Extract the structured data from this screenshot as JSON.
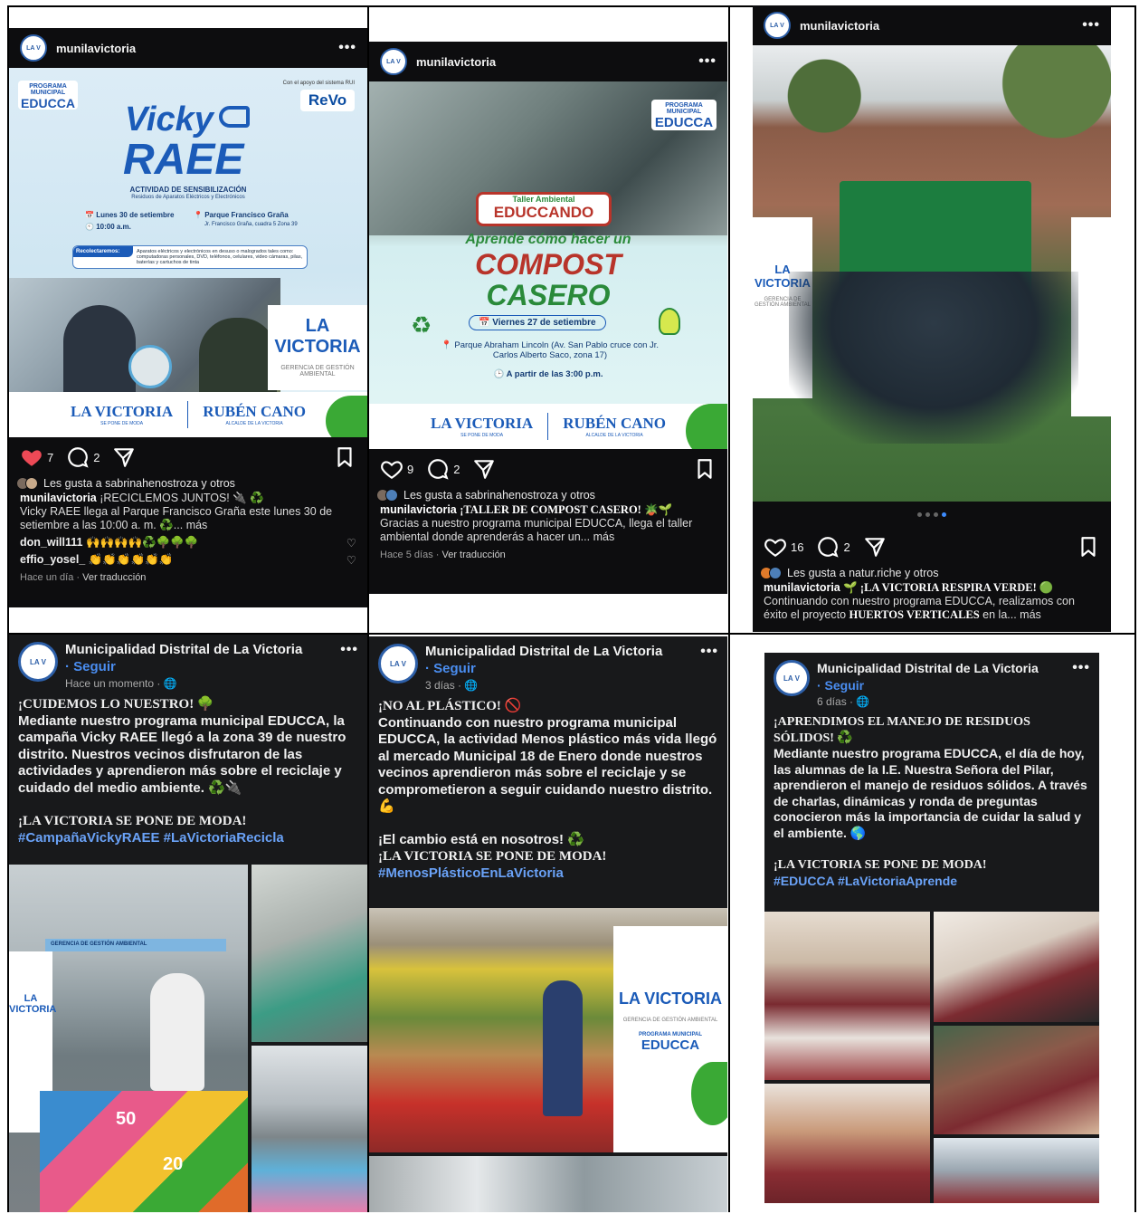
{
  "ig_posts": [
    {
      "username": "munilavictoria",
      "menu": "•••",
      "likes_count": "7",
      "comments_count": "2",
      "liked_by": "Les gusta a sabrinahenostroza y otros",
      "caption_user": "munilavictoria",
      "caption_title": "¡RECICLEMOS JUNTOS! 🔌 ♻️",
      "caption_body": "Vicky RAEE llega al Parque Francisco Graña este lunes 30 de setiembre a las 10:00 a. m. ♻️... más",
      "comments": [
        {
          "user": "don_will111",
          "text": "🙌🙌🙌🙌♻️🌳🌳🌳"
        },
        {
          "user": "effio_yosel_",
          "text": "👏👏👏👏👏👏"
        }
      ],
      "time": "Hace un día",
      "translate": "Ver traducción",
      "poster": {
        "program": "PROGRAMA MUNICIPAL",
        "educca": "EDUCCA",
        "partner_note": "Con el apoyo del sistema RUI",
        "partner": "ReVo",
        "title1": "Vicky",
        "title2": "RAEE",
        "subtitle": "ACTIVIDAD DE SENSIBILIZACIÓN",
        "subtitle2": "Residuos de Aparatos Eléctricos y Electrónicos",
        "date": "Lunes 30 de setiembre",
        "time": "10:00 a.m.",
        "place": "Parque Francisco Graña",
        "place2": "Jr. Francisco Graña, cuadra 5 Zona 39",
        "collect_label": "Recolectaremos:",
        "collect_text": "Aparatos eléctricos y electrónicos en desuso o malogrados tales como: computadoras personales, DVD, teléfonos, celulares, video cámaras, pilas, baterías y cartuchos de tinta",
        "brand": "LA VICTORIA",
        "brand_tag": "SE PONE DE MODA",
        "mayor": "RUBÉN CANO",
        "mayor_tag": "ALCALDE DE LA VICTORIA",
        "side_brand": "LA VICTORIA",
        "side_dept": "GERENCIA DE GESTIÓN AMBIENTAL"
      }
    },
    {
      "username": "munilavictoria",
      "menu": "•••",
      "likes_count": "9",
      "comments_count": "2",
      "liked_by": "Les gusta a sabrinahenostroza y otros",
      "caption_user": "munilavictoria",
      "caption_title": "¡TALLER DE COMPOST CASERO! 🪴🌱",
      "caption_body": "Gracias a nuestro programa municipal EDUCCA, llega el taller ambiental donde aprenderás a hacer un... más",
      "time": "Hace 5 días",
      "translate": "Ver traducción",
      "poster": {
        "program": "PROGRAMA MUNICIPAL",
        "educca": "EDUCCA",
        "tag1": "Taller Ambiental",
        "tag2": "EDUCCANDO",
        "line1": "Aprende cómo hacer un",
        "line2": "COMPOST",
        "line3": "CASERO",
        "date": "Viernes 27 de setiembre",
        "place": "Parque Abraham Lincoln (Av. San Pablo cruce con Jr. Carlos Alberto Saco, zona 17)",
        "time": "A partir de las 3:00 p.m.",
        "brand": "LA VICTORIA",
        "brand_tag": "SE PONE DE MODA",
        "mayor": "RUBÉN CANO",
        "mayor_tag": "ALCALDE DE LA VICTORIA"
      }
    },
    {
      "username": "munilavictoria",
      "menu": "•••",
      "likes_count": "16",
      "comments_count": "2",
      "liked_by": "Les gusta a natur.riche y otros",
      "caption_user": "munilavictoria",
      "caption_title": "🌱 ¡LA VICTORIA RESPIRA VERDE! 🟢",
      "caption_body_pre": "Continuando con nuestro programa EDUCCA, realizamos con éxito el proyecto ",
      "caption_bold": "HUERTOS VERTICALES",
      "caption_body_post": " en la... más",
      "photo_banner": "LA VICTORIA",
      "photo_banner2": "GERENCIA DE GESTIÓN AMBIENTAL"
    }
  ],
  "fb_posts": [
    {
      "page": "Municipalidad Distrital de La Victoria",
      "menu": "•••",
      "follow": "· Seguir",
      "time": "Hace un momento · 🌐",
      "headline": "¡CUIDEMOS LO NUESTRO! 🌳",
      "body": "Mediante nuestro programa municipal EDUCCA, la campaña Vicky RAEE llegó a la zona 39 de nuestro distrito. Nuestros vecinos disfrutaron de las actividades y aprendieron más sobre el reciclaje y cuidado del medio ambiente. ♻️🔌",
      "slogan": "¡LA VICTORIA SE PONE DE MODA!",
      "tags": "#CampañaVickyRAEE #LaVictoriaRecicla",
      "photo_label": "GERENCIA DE GESTIÓN AMBIENTAL",
      "photo_brand": "LA VICTORIA",
      "hop_numbers": [
        "50",
        "20"
      ]
    },
    {
      "page": "Municipalidad Distrital de La Victoria",
      "menu": "•••",
      "follow": "· Seguir",
      "time": "3 días · 🌐",
      "headline": "¡NO AL PLÁSTICO! 🚫",
      "body": "Continuando con nuestro programa municipal EDUCCA, la actividad Menos plástico más vida llegó al mercado Municipal 18 de Enero donde nuestros vecinos aprendieron más sobre el reciclaje y se comprometieron a seguir cuidando nuestro distrito. 💪",
      "cta": "¡El cambio está en nosotros! ♻️",
      "slogan": "¡LA VICTORIA SE PONE DE MODA!",
      "tags": "#MenosPlásticoEnLaVictoria",
      "banner_brand": "LA VICTORIA",
      "banner_dept": "GERENCIA DE GESTIÓN AMBIENTAL",
      "banner_program": "PROGRAMA MUNICIPAL",
      "banner_educca": "EDUCCA"
    },
    {
      "page": "Municipalidad Distrital de La Victoria",
      "menu": "•••",
      "follow": "· Seguir",
      "time": "6 días · 🌐",
      "headline": "¡APRENDIMOS EL MANEJO DE RESIDUOS SÓLIDOS! ♻️",
      "body": "Mediante nuestro programa EDUCCA, el día de hoy, las alumnas de la I.E. Nuestra Señora del Pilar, aprendieron el manejo de residuos sólidos. A través de charlas, dinámicas y ronda de preguntas conocieron más la importancia de cuidar la salud y el ambiente. 🌎",
      "slogan": "¡LA VICTORIA SE PONE DE MODA!",
      "tags": "#EDUCCA #LaVictoriaAprende"
    }
  ],
  "colors": {
    "ig_bg": "#0d0d0f",
    "fb_bg": "#18191b",
    "link_blue": "#4a8df0",
    "heart_red": "#ed4956",
    "brand_blue": "#1e57b0",
    "brand_green": "#3aa935",
    "compost_red": "#b8342a"
  }
}
